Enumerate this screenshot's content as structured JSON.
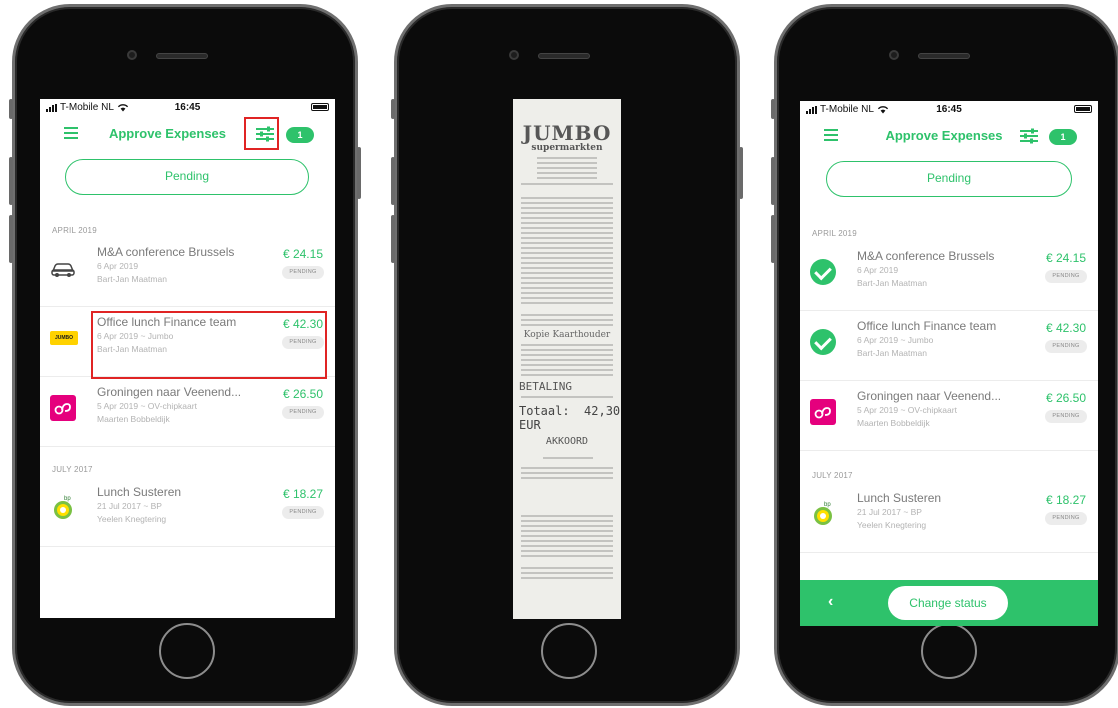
{
  "colors": {
    "accent": "#2ec26b",
    "highlight": "#e02424",
    "ov_pink": "#e5007d",
    "jumbo_yellow": "#ffd200"
  },
  "status": {
    "carrier": "T-Mobile NL",
    "time": "16:45"
  },
  "header": {
    "title": "Approve Expenses",
    "badge": "1"
  },
  "filter": {
    "pending_label": "Pending"
  },
  "sections": {
    "april": "APRIL 2019",
    "july": "JULY 2017"
  },
  "expenses": [
    {
      "name": "M&A conference Brussels",
      "date": "6 Apr 2019",
      "person": "Bart-Jan Maatman",
      "amount": "€ 24.15",
      "status": "PENDING",
      "icon": "car-icon"
    },
    {
      "name": "Office lunch Finance team",
      "date": "6 Apr 2019 ~ Jumbo",
      "person": "Bart-Jan Maatman",
      "amount": "€ 42.30",
      "status": "PENDING",
      "icon": "jumbo-logo"
    },
    {
      "name": "Groningen naar Veenend...",
      "date": "5 Apr 2019 ~ OV-chipkaart",
      "person": "Maarten Bobbeldijk",
      "amount": "€ 26.50",
      "status": "PENDING",
      "icon": "ov-chipkaart-logo"
    },
    {
      "name": "Lunch Susteren",
      "date": "21 Jul 2017 ~ BP",
      "person": "Yeelen Knegtering",
      "amount": "€ 18.27",
      "status": "PENDING",
      "icon": "bp-logo"
    }
  ],
  "receipt": {
    "brand": "JUMBO",
    "brand_sub": "supermarkten",
    "kaart": "Kopie Kaarthouder",
    "betaling": "BETALING",
    "total_label": "Totaal:",
    "total_value": "42,30 EUR",
    "akkoord": "AKKOORD"
  },
  "bottom": {
    "change_status": "Change status",
    "back_icon": "chevron-left-icon"
  }
}
